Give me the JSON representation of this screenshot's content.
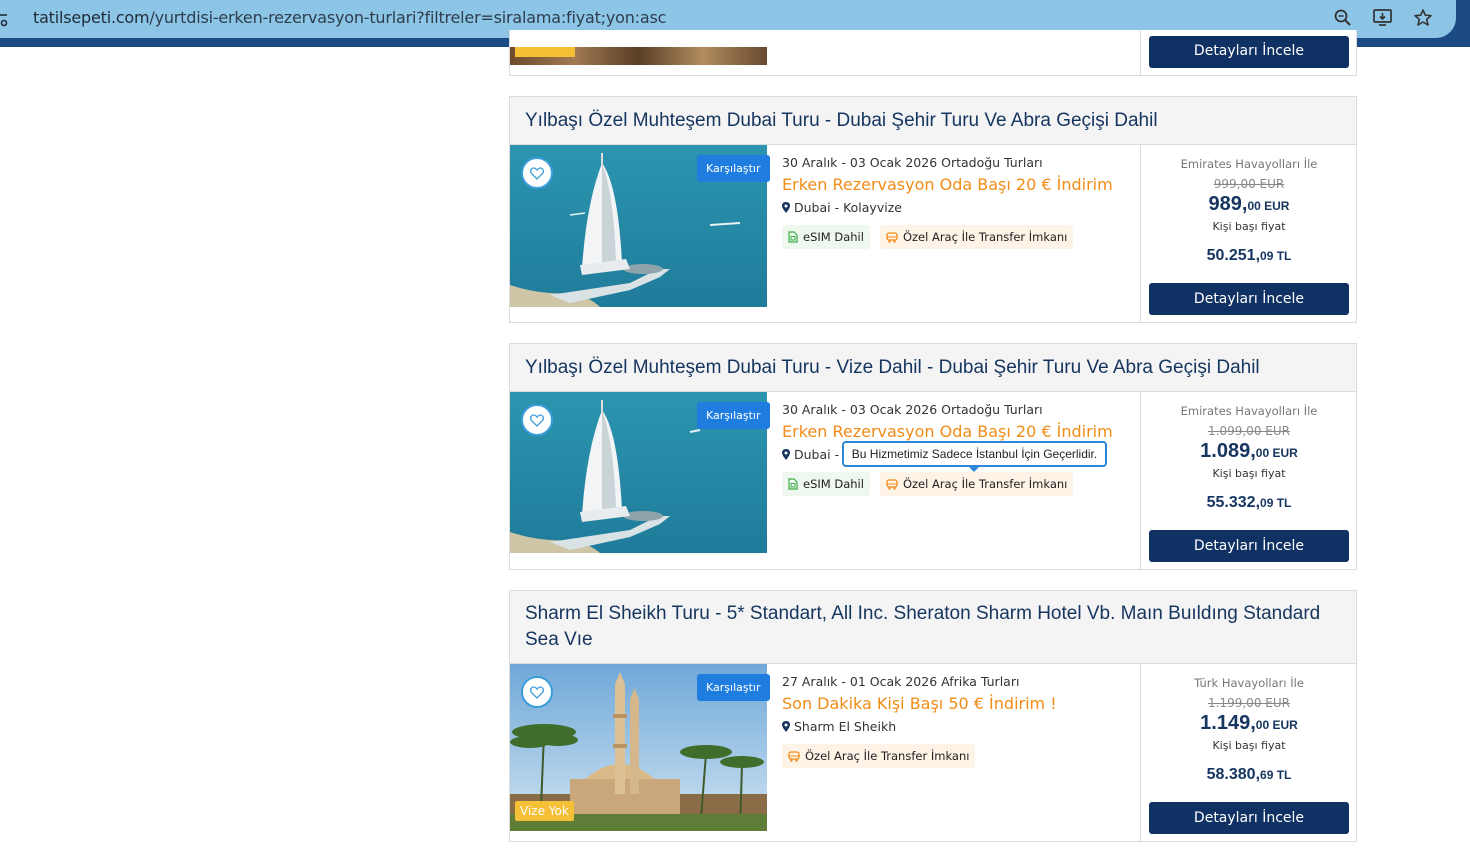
{
  "browser": {
    "url_host": "tatilsepeti.com",
    "url_path": "/yurtdisi-erken-rezervasyon-turlari?filtreler=siralama:fiyat;yon:asc"
  },
  "top_card": {
    "button_label": "Detayları İncele"
  },
  "cards": [
    {
      "title": "Yılbaşı Özel Muhteşem Dubai Turu - Dubai Şehir Turu Ve Abra Geçişi Dahil",
      "compare_label": "Karşılaştır",
      "date": "30 Aralık - 03 Ocak 2026 Ortadoğu Turları",
      "promo": "Erken Rezervasyon Oda Başı 20 € İndirim",
      "location": "Dubai - Kolayvize",
      "tags": [
        "eSIM Dahil",
        "Özel Araç İle Transfer İmkanı"
      ],
      "airline": "Emirates Havayolları İle",
      "old_price": "999,00 EUR",
      "price_main": "989,",
      "price_cents": "00 EUR",
      "per_person": "Kişi başı fiyat",
      "tl_main": "50.251,",
      "tl_cents": "09 TL",
      "button_label": "Detayları İncele"
    },
    {
      "title": "Yılbaşı Özel Muhteşem Dubai Turu - Vize Dahil - Dubai Şehir Turu Ve Abra Geçişi Dahil",
      "compare_label": "Karşılaştır",
      "date": "30 Aralık - 03 Ocak 2026 Ortadoğu Turları",
      "promo": "Erken Rezervasyon Oda Başı 20 € İndirim",
      "location": "Dubai -",
      "tags": [
        "eSIM Dahil",
        "Özel Araç İle Transfer İmkanı"
      ],
      "airline": "Emirates Havayolları İle",
      "old_price": "1.099,00 EUR",
      "price_main": "1.089,",
      "price_cents": "00 EUR",
      "per_person": "Kişi başı fiyat",
      "tl_main": "55.332,",
      "tl_cents": "09 TL",
      "button_label": "Detayları İncele"
    },
    {
      "title": "Sharm El Sheikh Turu - 5* Standart, All Inc. Sheraton Sharm Hotel Vb. Maın Buıldıng Standard Sea Vıe",
      "compare_label": "Karşılaştır",
      "badge": "Vize Yok",
      "date": "27 Aralık - 01 Ocak 2026 Afrika Turları",
      "promo": "Son Dakika Kişi Başı 50 € İndirim !",
      "location": "Sharm El Sheikh",
      "tags": [
        "Özel Araç İle Transfer İmkanı"
      ],
      "airline": "Türk Havayolları İle",
      "old_price": "1.199,00 EUR",
      "price_main": "1.149,",
      "price_cents": "00 EUR",
      "per_person": "Kişi başı fiyat",
      "tl_main": "58.380,",
      "tl_cents": "69 TL",
      "button_label": "Detayları İncele"
    }
  ],
  "tooltip": "Bu Hizmetimiz Sadece İstanbul İçin Geçerlidir."
}
